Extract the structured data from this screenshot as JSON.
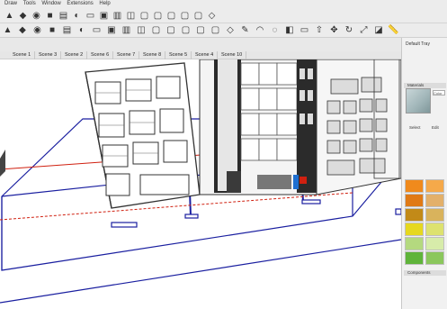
{
  "menu": [
    "Draw",
    "Tools",
    "Window",
    "Extensions",
    "Help"
  ],
  "toolbar1_icons": [
    "select-icon",
    "paint-bucket-icon",
    "component-icon",
    "cube-icon",
    "layers-icon",
    "shadow-icon",
    "open-icon",
    "save-icon",
    "print-icon",
    "camera-icon",
    "view-front-icon",
    "view-right-icon",
    "view-back-icon",
    "view-left-icon",
    "view-top-icon",
    "view-iso-icon"
  ],
  "toolbar2_icons": [
    "pencil-icon",
    "arc-icon",
    "lasso-icon",
    "eraser-icon",
    "rectangle-icon",
    "pushpull-icon",
    "move-icon",
    "rotate-icon",
    "scale-icon",
    "offset-icon",
    "tape-icon",
    "dimension-icon",
    "protractor-icon",
    "text-icon",
    "axes-icon",
    "3dtext-icon",
    "orbit-icon",
    "pan-icon",
    "zoom-icon",
    "zoom-extents-icon",
    "walk-icon",
    "look-icon",
    "section-icon",
    "sandbox-icon",
    "ruby-icon",
    "warehouse-icon",
    "extension-icon"
  ],
  "scenes": [
    "Scene 1",
    "Scene 3",
    "Scene 2",
    "Scene 6",
    "Scene 7",
    "Scene 8",
    "Scene 5",
    "Scene 4",
    "Scene 10"
  ],
  "panel": {
    "title": "Default Tray",
    "materials_section": "Materials",
    "material_name": "Color",
    "tab_select": "Select",
    "tab_edit": "Edit",
    "components_section": "Components"
  },
  "swatch_colors": [
    "#f08a1c",
    "#f5a94a",
    "#e07a16",
    "#e3b06a",
    "#c28a18",
    "#d9b35c",
    "#e6d81f",
    "#dde26f",
    "#b4d97f",
    "#d7ecaa",
    "#5fb43a",
    "#8bc75c"
  ],
  "colors": {
    "selection_blue": "#1a1fa0",
    "red_axis": "#d02010",
    "toolbar_bg": "#ececec"
  }
}
